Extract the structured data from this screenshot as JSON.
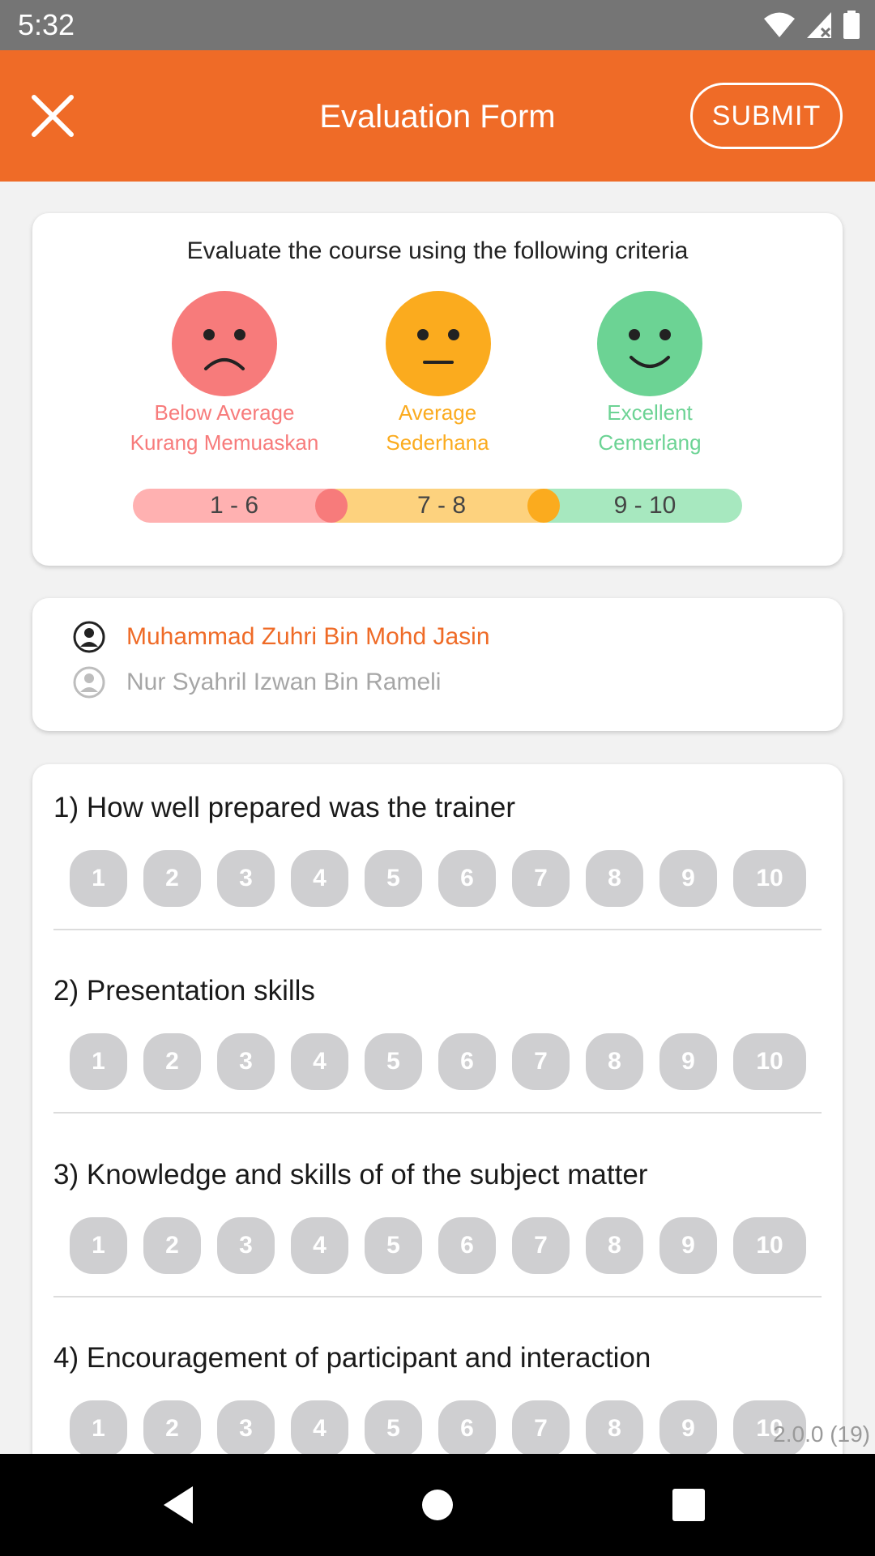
{
  "status_bar": {
    "time": "5:32"
  },
  "app_bar": {
    "title": "Evaluation Form",
    "submit_label": "SUBMIT"
  },
  "criteria": {
    "title": "Evaluate the course using the following criteria",
    "levels": [
      {
        "line1": "Below Average",
        "line2": "Kurang Memuaskan",
        "color": "#f77b7b"
      },
      {
        "line1": "Average",
        "line2": "Sederhana",
        "color": "#fbab1e"
      },
      {
        "line1": "Excellent",
        "line2": "Cemerlang",
        "color": "#6cd394"
      }
    ],
    "ranges": [
      "1 - 6",
      "7 - 8",
      "9 - 10"
    ]
  },
  "trainers": [
    {
      "name": "Muhammad Zuhri Bin Mohd Jasin",
      "selected": true
    },
    {
      "name": "Nur Syahril Izwan Bin Rameli",
      "selected": false
    }
  ],
  "questions": [
    {
      "text": "1) How well prepared was the trainer"
    },
    {
      "text": "2) Presentation skills"
    },
    {
      "text": "3) Knowledge and skills of of the subject matter"
    },
    {
      "text": "4) Encouragement of participant and interaction"
    }
  ],
  "scores": [
    "1",
    "2",
    "3",
    "4",
    "5",
    "6",
    "7",
    "8",
    "9",
    "10"
  ],
  "version": "2.0.0 (19)"
}
